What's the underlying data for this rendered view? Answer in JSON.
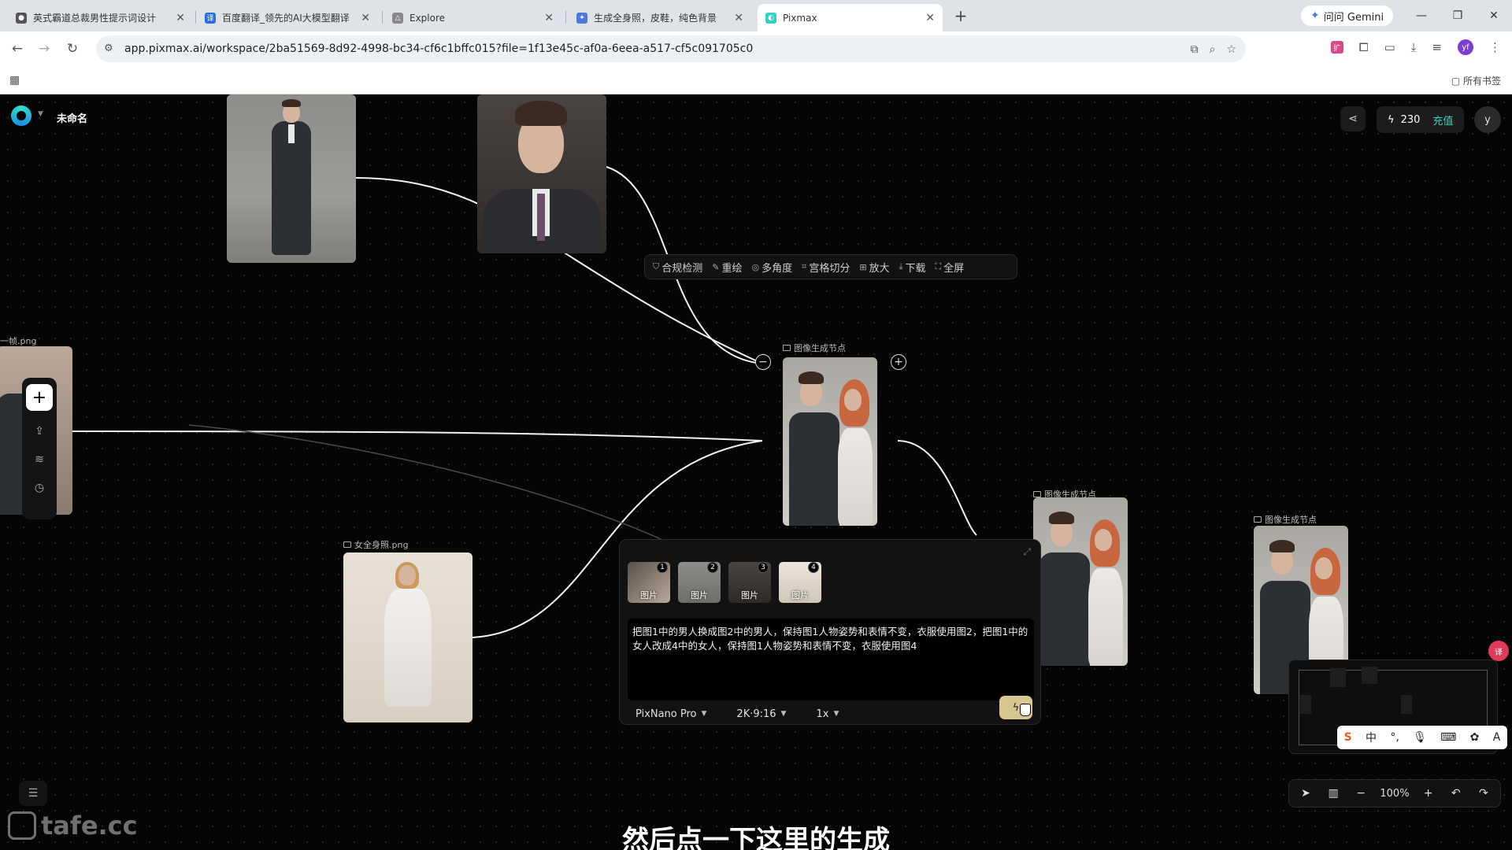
{
  "browser": {
    "tabs": [
      {
        "title": "英式霸道总裁男性提示词设计",
        "icon_color": "#555555"
      },
      {
        "title": "百度翻译_领先的AI大模型翻译",
        "icon_color": "#2b6de3"
      },
      {
        "title": "Explore",
        "icon_color": "#888888"
      },
      {
        "title": "生成全身照，皮鞋，纯色背景",
        "icon_color": "#4a7bd8"
      },
      {
        "title": "Pixmax",
        "icon_color": "#2ed3c5"
      }
    ],
    "gemini_label": "问问 Gemini",
    "url": "app.pixmax.ai/workspace/2ba51569-8d92-4998-bc34-cf6c1bffc015?file=1f13e45c-af0a-6eea-a517-cf5c091705c0",
    "all_bookmarks": "所有书签",
    "profile_initial": "yf"
  },
  "app": {
    "project_title": "未命名",
    "credits": "230",
    "recharge_label": "充值",
    "user_initial": "y",
    "accent_color": "#2ed3c5"
  },
  "nodes": {
    "left_partial_label": "一帧.png",
    "center_label": "图像生成节点",
    "right1_label": "图像生成节点",
    "right2_label": "图像生成节点",
    "woman_label": "女全身照.png"
  },
  "actionbar": {
    "items": [
      "合规检测",
      "重绘",
      "多角度",
      "宫格切分",
      "放大",
      "下载",
      "全屏"
    ]
  },
  "prompt_panel": {
    "thumbs": [
      {
        "num": "1",
        "label": "图片"
      },
      {
        "num": "2",
        "label": "图片"
      },
      {
        "num": "3",
        "label": "图片"
      },
      {
        "num": "4",
        "label": "图片"
      }
    ],
    "prompt": "把图1中的男人换成图2中的男人，保持图1人物姿势和表情不变，衣服使用图2，把图1中的女人改成4中的女人，保持图1人物姿势和表情不变，衣服使用图4",
    "model": "PixNano Pro",
    "resolution": "2K·9:16",
    "count": "1x"
  },
  "zoom": "100%",
  "watermark": "tafe.cc",
  "subtitle": "然后点一下这里的生成"
}
